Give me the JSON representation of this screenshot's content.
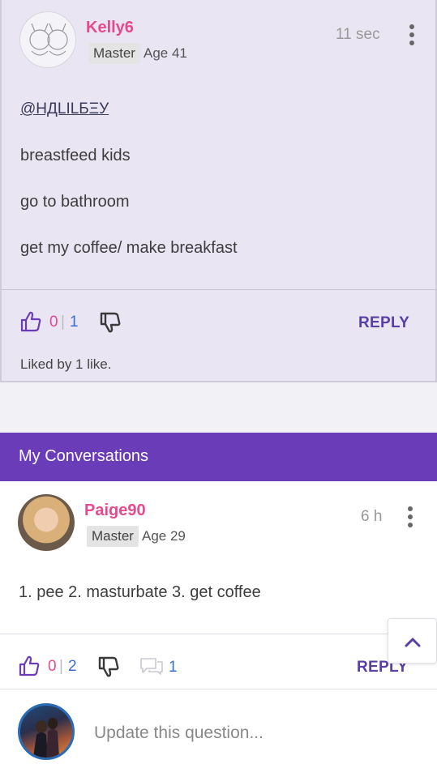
{
  "post": {
    "username": "Kelly6",
    "rank": "Master",
    "age": "Age 41",
    "time": "11 sec",
    "mention": "@НДLILБΞУ",
    "lines": [
      "breastfeed kids",
      "go to bathroom",
      "get my coffee/ make breakfast"
    ],
    "likes": "0",
    "separator": "|",
    "dislikes_count": "1",
    "reply_label": "REPLY",
    "liked_by": "Liked by 1 like."
  },
  "section": {
    "title": "My Conversations"
  },
  "conversation": {
    "username": "Paige90",
    "rank": "Master",
    "age": "Age 29",
    "time": "6 h",
    "body": "1. pee 2. masturbate 3. get coffee",
    "likes": "0",
    "separator": "|",
    "dislikes_count": "2",
    "comments": "1",
    "reply_label": "REPLY"
  },
  "composer": {
    "placeholder": "Update this question..."
  },
  "colors": {
    "accent": "#6b3cb8",
    "username": "#e54a8f",
    "highlight": "#e9e5f3"
  }
}
